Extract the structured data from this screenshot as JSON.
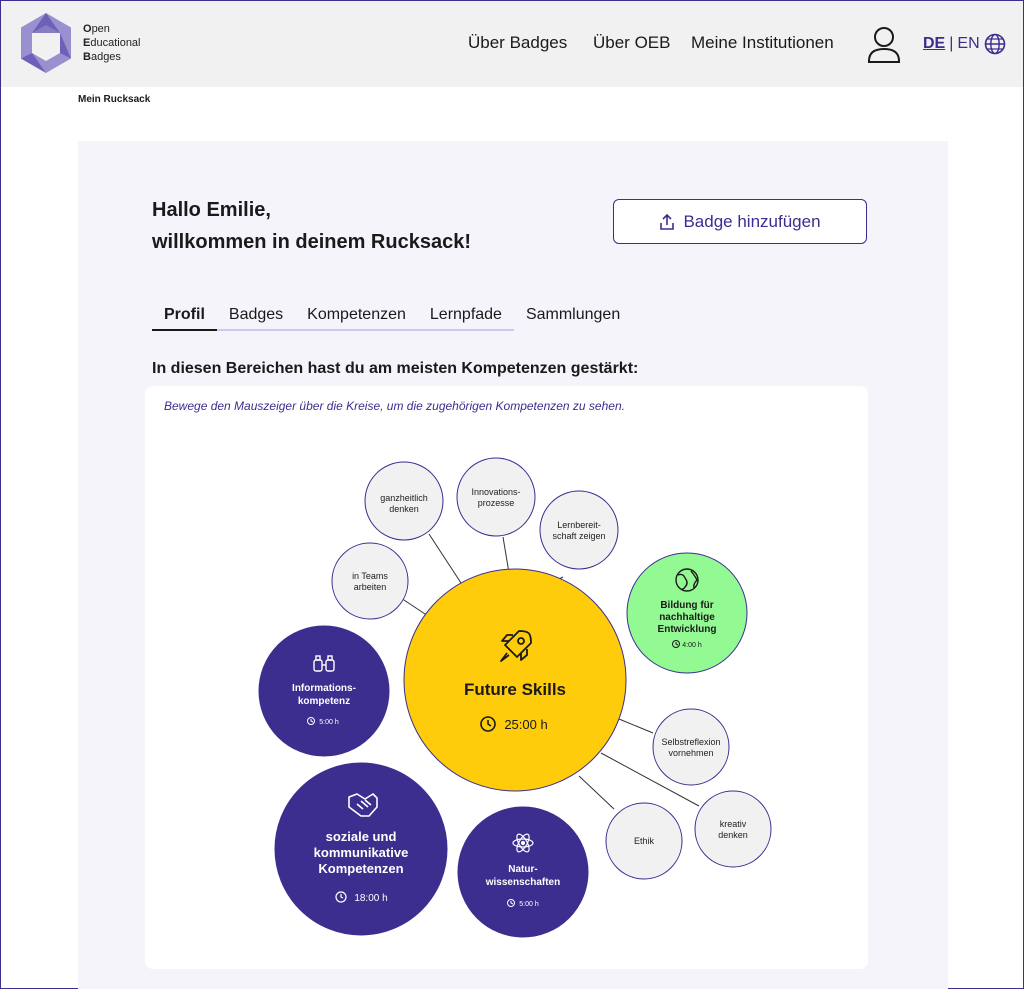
{
  "logo": {
    "line1_bold": "O",
    "line1": "pen",
    "line2_bold": "E",
    "line2": "ducational",
    "line3_bold": "B",
    "line3": "adges"
  },
  "nav": {
    "item1": "Über Badges",
    "item2": "Über OEB",
    "item3": "Meine Institutionen"
  },
  "lang": {
    "de": "DE",
    "sep": "|",
    "en": "EN"
  },
  "breadcrumb": "Mein Rucksack",
  "greeting": {
    "line1": "Hallo Emilie,",
    "line2": "willkommen in deinem Rucksack!"
  },
  "add_badge_label": "Badge hinzufügen",
  "tabs": [
    "Profil",
    "Badges",
    "Kompetenzen",
    "Lernpfade",
    "Sammlungen"
  ],
  "section_title": "In diesen Bereichen hast du am meisten Kompetenzen gestärkt:",
  "hint": "Bewege den Mauszeiger über die Kreise, um die zugehörigen Kompetenzen zu sehen.",
  "colors": {
    "accent": "#3b2e8f",
    "yellow": "#ffcc0c",
    "green": "#93f993",
    "grey_bubble": "#f1f1f1"
  },
  "bubbles": {
    "main": {
      "title": "Future Skills",
      "time": "25:00 h",
      "icon": "rocket-icon"
    },
    "info": {
      "line1": "Informations-",
      "line2": "kompetenz",
      "time": "5:00 h",
      "icon": "binoculars-icon"
    },
    "social": {
      "line1": "soziale und",
      "line2": "kommunikative",
      "line3": "Kompetenzen",
      "time": "18:00 h",
      "icon": "handshake-icon"
    },
    "nature": {
      "line1": "Natur-",
      "line2": "wissenschaften",
      "time": "5:00 h",
      "icon": "atom-icon"
    },
    "bne": {
      "line1": "Bildung für",
      "line2": "nachhaltige",
      "line3": "Entwicklung",
      "time": "4:00 h",
      "icon": "globe-icon"
    }
  },
  "skills": {
    "teams": {
      "line1": "in Teams",
      "line2": "arbeiten"
    },
    "ganzheitlich": {
      "line1": "ganzheitlich",
      "line2": "denken"
    },
    "innovation": {
      "line1": "Innovations-",
      "line2": "prozesse"
    },
    "lernbereit": {
      "line1": "Lernbereit-",
      "line2": "schaft zeigen"
    },
    "selbstreflexion": {
      "line1": "Selbstreflexion",
      "line2": "vornehmen"
    },
    "kreativ": {
      "line1": "kreativ",
      "line2": "denken"
    },
    "ethik": {
      "line1": "Ethik"
    }
  }
}
